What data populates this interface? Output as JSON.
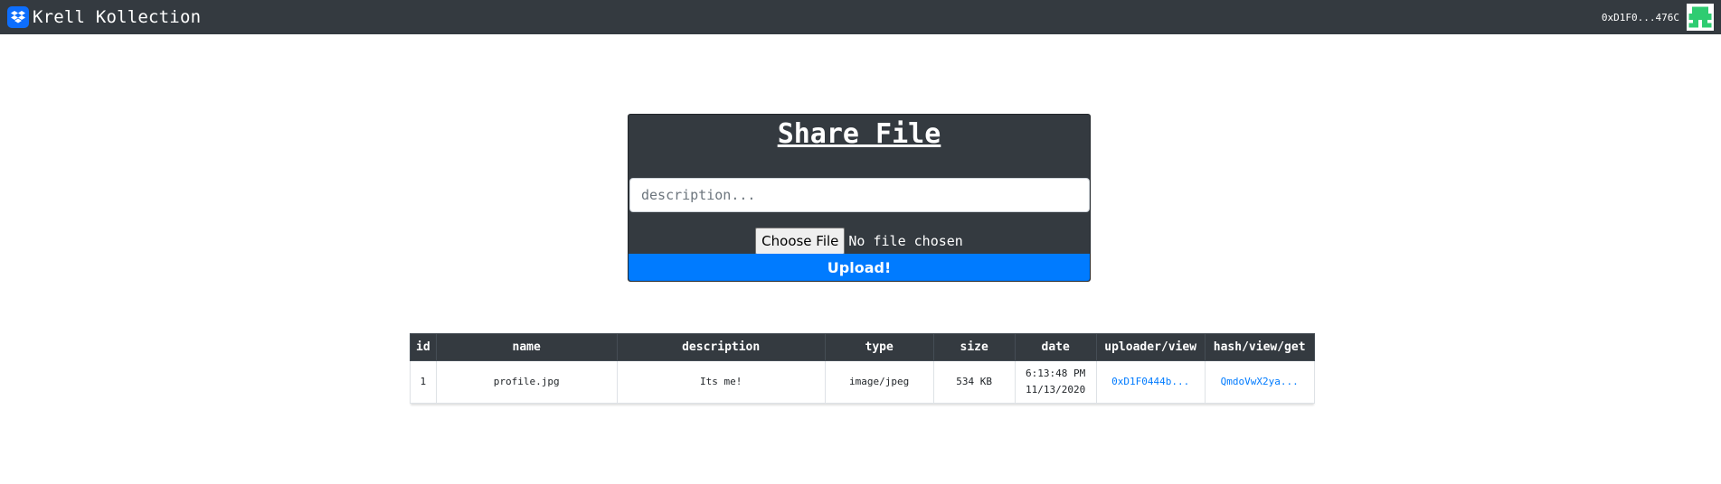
{
  "navbar": {
    "brand": "Krell Kollection",
    "account": "0xD1F0...476C",
    "brand_icon": "dropbox-icon",
    "identicon": "identicon-avatar"
  },
  "share_card": {
    "title": "Share File",
    "description_placeholder": "description...",
    "choose_file_label": "Choose File",
    "no_file_text": "No file chosen",
    "upload_label": "Upload!"
  },
  "table": {
    "headers": [
      "id",
      "name",
      "description",
      "type",
      "size",
      "date",
      "uploader/view",
      "hash/view/get"
    ],
    "rows": [
      {
        "id": "1",
        "name": "profile.jpg",
        "description": "Its me!",
        "type": "image/jpeg",
        "size": "534 KB",
        "time": "6:13:48 PM",
        "date": "11/13/2020",
        "uploader": "0xD1F0444b...",
        "hash": "QmdoVwX2ya..."
      }
    ]
  },
  "colors": {
    "navbar_bg": "#343a40",
    "accent": "#007bff",
    "identicon": "#2ecc71"
  }
}
